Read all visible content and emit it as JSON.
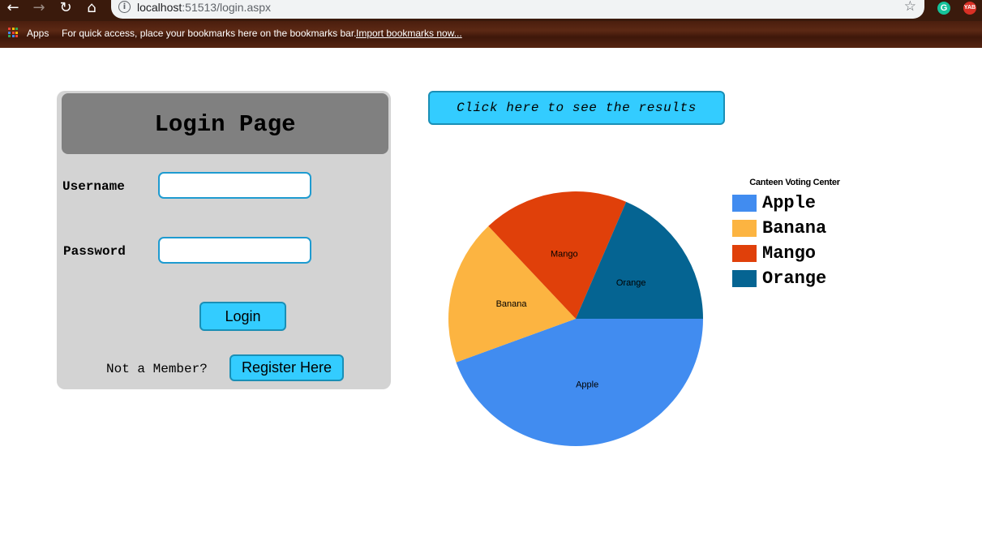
{
  "browser": {
    "url_host": "localhost",
    "url_path": ":51513/login.aspx",
    "extensions": [
      "G",
      "YAB"
    ],
    "bookmarks_bar": {
      "apps_label": "Apps",
      "message": "For quick access, place your bookmarks here on the bookmarks bar.",
      "import_link": "Import bookmarks now..."
    }
  },
  "login": {
    "title": "Login Page",
    "username_label": "Username",
    "password_label": "Password",
    "username_value": "",
    "password_value": "",
    "login_button": "Login",
    "member_prompt": "Not a Member?",
    "register_button": "Register Here"
  },
  "results_button": "Click here to see the results",
  "chart_data": {
    "type": "pie",
    "title": "Canteen Voting Center",
    "legend_position": "right",
    "categories": [
      "Apple",
      "Banana",
      "Mango",
      "Orange"
    ],
    "values": [
      44.4,
      18.5,
      18.5,
      18.5
    ],
    "colors": [
      "#418cf0",
      "#fcb441",
      "#e0400a",
      "#056492"
    ]
  }
}
